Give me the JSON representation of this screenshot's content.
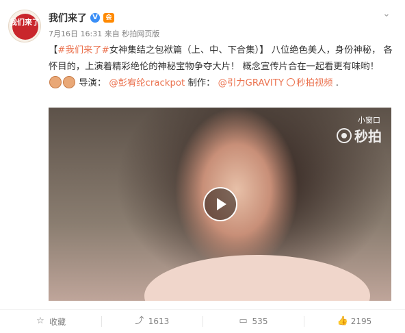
{
  "post": {
    "avatar_text": "我们来了",
    "username": "我们来了",
    "verified_badge": "V",
    "level_badge": "会",
    "time": "7月16日 16:31",
    "source_prefix": "来自",
    "source": "秒拍网页版",
    "content": {
      "bracket_open": "【",
      "hashtag": "#我们来了#",
      "title": "女神集结之包袱篇（上、中、下合集）",
      "bracket_close": "】",
      "body": "八位绝色美人，身份神秘， 各怀目的，上演着精彩绝伦的神秘宝物争夺大片！ 概念宣传片合在一起看更有味哟！",
      "director_label": "导演：",
      "director_mention": "@彭宥纶crackpot",
      "producer_label": "制作：",
      "producer_mention": "@引力GRAVITY",
      "video_link": "秒拍视频",
      "end_punct": "."
    },
    "video": {
      "mini_window_label": "小窗口",
      "watermark": "秒拍"
    }
  },
  "actions": [
    {
      "icon": "star-icon",
      "label": "收藏"
    },
    {
      "icon": "forward-icon",
      "label": "1613"
    },
    {
      "icon": "comment-icon",
      "label": "535"
    },
    {
      "icon": "like-icon",
      "label": "2195"
    }
  ],
  "colors": {
    "link": "#eb7350",
    "meta": "#808080",
    "text": "#333333"
  }
}
